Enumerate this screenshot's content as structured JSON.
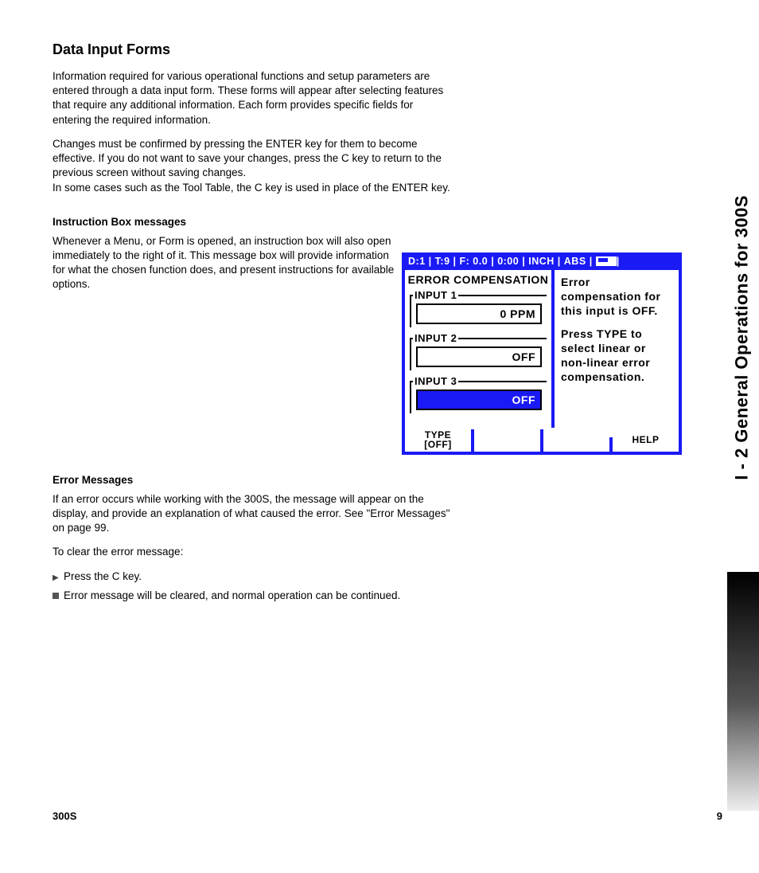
{
  "heading": "Data Input Forms",
  "para1": "Information required for various operational functions and setup parameters are entered through a data input form. These forms will appear after selecting features that require any additional information. Each form provides specific fields for entering the required information.",
  "para2a": "Changes must be confirmed by pressing the ENTER key for them to become effective. If you do not want to save your changes, press the C key to return to the previous screen without saving changes.",
  "para2b": "In some cases such as the Tool Table, the C key is used in place of the ENTER key.",
  "sub1": "Instruction Box messages",
  "para3": "Whenever a Menu, or Form is opened, an instruction box will also open immediately to the right of it. This message box will provide information for what the chosen function does, and present instructions for available options.",
  "sub2": "Error Messages",
  "para4": "If an error occurs while working with the 300S, the message will appear on the display, and provide an explanation of what caused the error. See \"Error Messages\" on page 99.",
  "para5": "To clear the error message:",
  "li1": "Press the C key.",
  "li2": "Error message will be cleared, and normal operation can be continued.",
  "side_tab": "I - 2 General Operations for 300S",
  "footer_left": "300S",
  "footer_right": "9",
  "dro": {
    "top": {
      "d": "D:1",
      "t": "T:9",
      "f": "F: 0.0",
      "time": "0:00",
      "unit": "INCH",
      "mode": "ABS"
    },
    "left_title": "ERROR COMPENSATION",
    "inputs": [
      {
        "label": "INPUT 1",
        "value": "0 PPM",
        "active": false
      },
      {
        "label": "INPUT 2",
        "value": "OFF",
        "active": false
      },
      {
        "label": "INPUT 3",
        "value": "OFF",
        "active": true
      }
    ],
    "right_line1": "Error compensation for this input is OFF.",
    "right_line2": "Press TYPE to select linear or non-linear error compensation.",
    "softkeys": {
      "sk1a": "TYPE",
      "sk1b": "[OFF]",
      "sk2": "",
      "sk3": "",
      "sk4": "HELP"
    }
  }
}
